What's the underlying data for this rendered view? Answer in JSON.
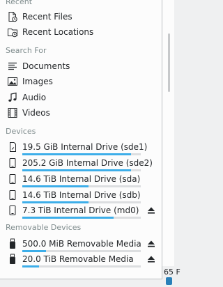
{
  "sections": {
    "recent": "Recent",
    "search_for": "Search For",
    "devices": "Devices",
    "removable": "Removable Devices"
  },
  "recent_items": [
    {
      "label": "Recent Files",
      "icon": "recent-files-icon"
    },
    {
      "label": "Recent Locations",
      "icon": "recent-locations-icon"
    }
  ],
  "search_items": [
    {
      "label": "Documents",
      "icon": "documents-icon"
    },
    {
      "label": "Images",
      "icon": "images-icon"
    },
    {
      "label": "Audio",
      "icon": "audio-icon"
    },
    {
      "label": "Videos",
      "icon": "videos-icon"
    }
  ],
  "devices": [
    {
      "label": "19.5 GiB Internal Drive (sde1)",
      "icon": "sd-card-icon",
      "capacity_used": 0.92,
      "ejectable": false
    },
    {
      "label": "205.2 GiB Internal Drive (sde2)",
      "icon": "drive-icon",
      "capacity_used": 0.92,
      "ejectable": false
    },
    {
      "label": "14.6 TiB Internal Drive (sda)",
      "icon": "drive-icon",
      "capacity_used": 0.56,
      "ejectable": false
    },
    {
      "label": "14.6 TiB Internal Drive (sdb)",
      "icon": "drive-icon",
      "capacity_used": 0.56,
      "ejectable": false
    },
    {
      "label": "7.3 TiB Internal Drive (md0)",
      "icon": "drive-icon",
      "capacity_used": 0.77,
      "ejectable": true
    }
  ],
  "removable_devices": [
    {
      "label": "500.0 MiB Removable Media",
      "icon": "usb-drive-icon",
      "capacity_used": 0.2,
      "ejectable": true
    },
    {
      "label": "20.0 TiB Removable Media",
      "icon": "usb-drive-icon",
      "capacity_used": 0.14,
      "ejectable": true
    }
  ],
  "status": {
    "text": "65 F"
  },
  "colors": {
    "accent": "#3daee9",
    "track": "#dcdee0",
    "section_text": "#7f8c8d"
  }
}
